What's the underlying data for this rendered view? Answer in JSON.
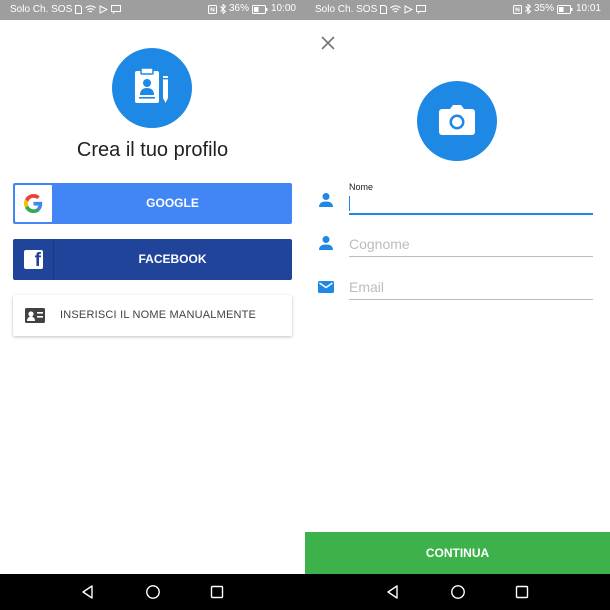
{
  "colors": {
    "accent_blue": "#1e88e5",
    "google_blue": "#4285f4",
    "facebook_blue": "#21449b",
    "continue_green": "#3eb24a",
    "status_bar_gray": "#9e9e9e"
  },
  "left_screen": {
    "status_bar": {
      "carrier": "Solo Ch. SOS",
      "battery": "36%",
      "time": "10:00",
      "icons": [
        "sim-icon",
        "wifi-icon",
        "play-protect-icon",
        "message-icon",
        "nfc-icon",
        "bluetooth-icon",
        "battery-icon"
      ]
    },
    "title": "Crea il tuo profilo",
    "header_icon": "clipboard-profile-icon",
    "buttons": {
      "google": "GOOGLE",
      "facebook": "FACEBOOK",
      "manual": "INSERISCI IL NOME MANUALMENTE"
    }
  },
  "right_screen": {
    "status_bar": {
      "carrier": "Solo Ch. SOS",
      "battery": "35%",
      "time": "10:01",
      "icons": [
        "sim-icon",
        "wifi-icon",
        "play-protect-icon",
        "message-icon",
        "nfc-icon",
        "bluetooth-icon",
        "battery-icon"
      ]
    },
    "header_icon": "camera-icon",
    "fields": {
      "first_name_label": "Nome",
      "first_name_value": "",
      "last_name_placeholder": "Cognome",
      "email_placeholder": "Email"
    },
    "continue_button": "CONTINUA"
  },
  "nav_bar": {
    "icons": [
      "back-icon",
      "home-icon",
      "recent-apps-icon"
    ]
  }
}
